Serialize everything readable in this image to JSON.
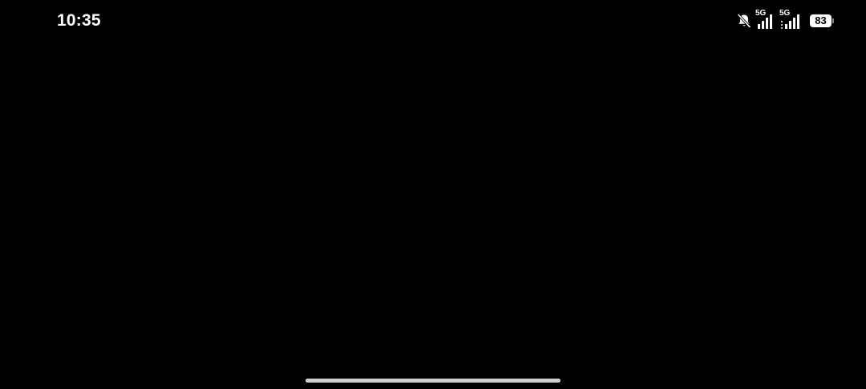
{
  "status_bar": {
    "time": "10:35",
    "silent_icon": "bell-off-icon",
    "sim1": {
      "network": "5G",
      "signal_bars": 4
    },
    "sim2": {
      "network": "5G",
      "signal_bars": 4
    },
    "battery_level": "83"
  },
  "colors": {
    "background": "#000000",
    "foreground": "#ffffff",
    "home_indicator": "#cfcfcf"
  }
}
